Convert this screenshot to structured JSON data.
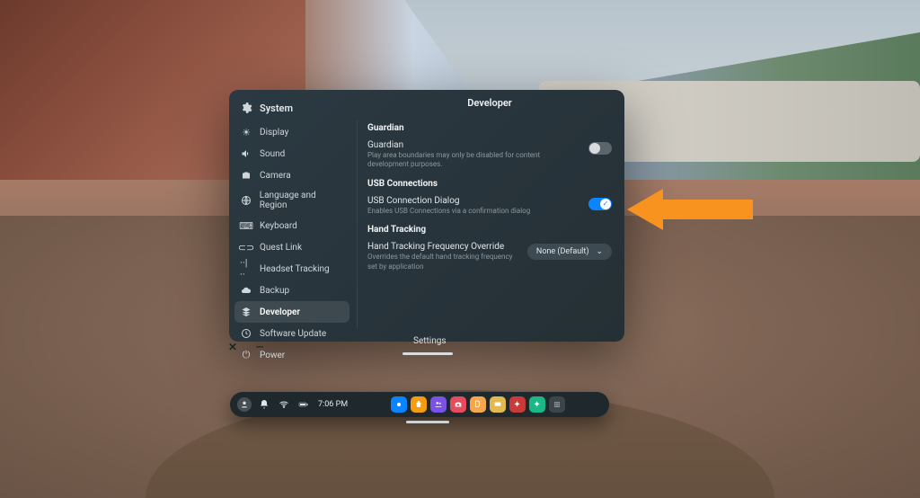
{
  "header": {
    "section": "System",
    "page": "Developer",
    "window_label": "Settings"
  },
  "colors": {
    "accent": "#0a84ff",
    "arrow": "#f7931e"
  },
  "sidebar": {
    "items": [
      {
        "label": "Display",
        "icon": "brightness-icon"
      },
      {
        "label": "Sound",
        "icon": "sound-icon"
      },
      {
        "label": "Camera",
        "icon": "camera-icon"
      },
      {
        "label": "Language and Region",
        "icon": "globe-icon"
      },
      {
        "label": "Keyboard",
        "icon": "keyboard-icon"
      },
      {
        "label": "Quest Link",
        "icon": "link-icon"
      },
      {
        "label": "Headset Tracking",
        "icon": "tracking-icon"
      },
      {
        "label": "Backup",
        "icon": "cloud-icon"
      },
      {
        "label": "Developer",
        "icon": "developer-icon",
        "active": true
      },
      {
        "label": "Software Update",
        "icon": "update-icon"
      },
      {
        "label": "Power",
        "icon": "power-icon"
      }
    ]
  },
  "sections": {
    "guardian": {
      "title": "Guardian",
      "item": {
        "label": "Guardian",
        "desc": "Play area boundaries may only be disabled for content development purposes.",
        "value": false
      }
    },
    "usb": {
      "title": "USB Connections",
      "item": {
        "label": "USB Connection Dialog",
        "desc": "Enables USB Connections via a confirmation dialog",
        "value": true
      }
    },
    "hand": {
      "title": "Hand Tracking",
      "item": {
        "label": "Hand Tracking Frequency Override",
        "desc": "Overrides the default hand tracking frequency set by application",
        "selected": "None (Default)"
      }
    }
  },
  "taskbar": {
    "time": "7:06 PM",
    "status": [
      {
        "name": "profile-icon"
      },
      {
        "name": "notification-icon"
      },
      {
        "name": "wifi-icon"
      },
      {
        "name": "battery-icon"
      }
    ],
    "apps": [
      {
        "name": "explore-app",
        "color": "#0a84ff"
      },
      {
        "name": "store-app",
        "color": "#f59b0f"
      },
      {
        "name": "people-app",
        "color": "#7b51e6"
      },
      {
        "name": "camera-app",
        "color": "#e64c5f"
      },
      {
        "name": "browser-app",
        "color": "#f4a64b"
      },
      {
        "name": "tv-app",
        "color": "#e2b94e"
      },
      {
        "name": "horizon-app",
        "color": "#c93a3a"
      },
      {
        "name": "messenger-app",
        "color": "#19b886"
      },
      {
        "name": "app-library",
        "color": "#3b464c"
      }
    ]
  }
}
